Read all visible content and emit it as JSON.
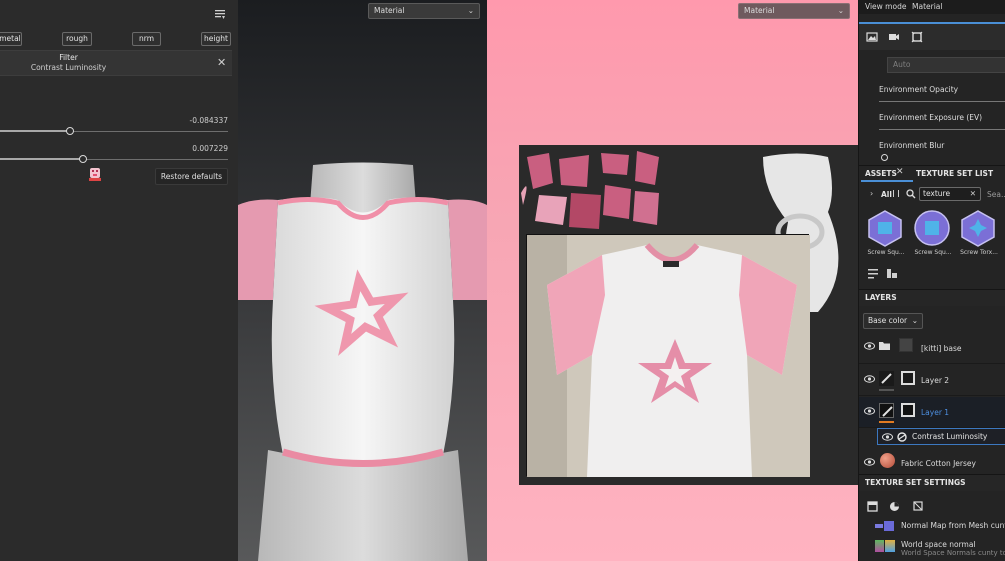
{
  "left_panel": {
    "channels": [
      "metal",
      "rough",
      "nrm",
      "height"
    ],
    "filter": {
      "title": "Filter",
      "name": "Contrast Luminosity"
    },
    "sliders": [
      {
        "value_text": "-0.084337",
        "position": 0.3
      },
      {
        "value_text": "0.007229",
        "position": 0.36
      }
    ],
    "restore_label": "Restore defaults"
  },
  "viewport_3d": {
    "mode_label": "Material"
  },
  "viewport_2d": {
    "mode_label": "Material"
  },
  "display_settings": {
    "header_left": "View mode",
    "header_right": "Material",
    "auto_label": "Auto",
    "env_opacity": "Environment Opacity",
    "env_exposure": "Environment Exposure (EV)",
    "env_blur": "Environment Blur"
  },
  "assets": {
    "tab_assets": "ASSETS",
    "tab_texture_set": "TEXTURE SET LIST",
    "all_label": "All",
    "search_value": "texture",
    "search_hint": "Sea...",
    "items": [
      {
        "caption": "Screw Squ..."
      },
      {
        "caption": "Screw Squ..."
      },
      {
        "caption": "Screw Torx..."
      }
    ]
  },
  "layers": {
    "title": "LAYERS",
    "channel_select": "Base color",
    "items": [
      {
        "name": "[kitti] base"
      },
      {
        "name": "Layer 2"
      },
      {
        "name": "Layer 1"
      },
      {
        "name": "Contrast Luminosity"
      },
      {
        "name": "Fabric Cotton Jersey"
      }
    ]
  },
  "texture_set_settings": {
    "title": "TEXTURE SET SETTINGS",
    "rows": [
      {
        "line1": "Normal Map from Mesh cunty",
        "line2": ""
      },
      {
        "line1": "World space normal",
        "line2": "World Space Normals cunty to"
      }
    ]
  },
  "colors": {
    "accent_blue": "#4a8fd6",
    "selected_layer_text": "#4d8fe0",
    "shirt_pink": "#f29bb2",
    "layer_progress_orange": "#e07b22"
  }
}
